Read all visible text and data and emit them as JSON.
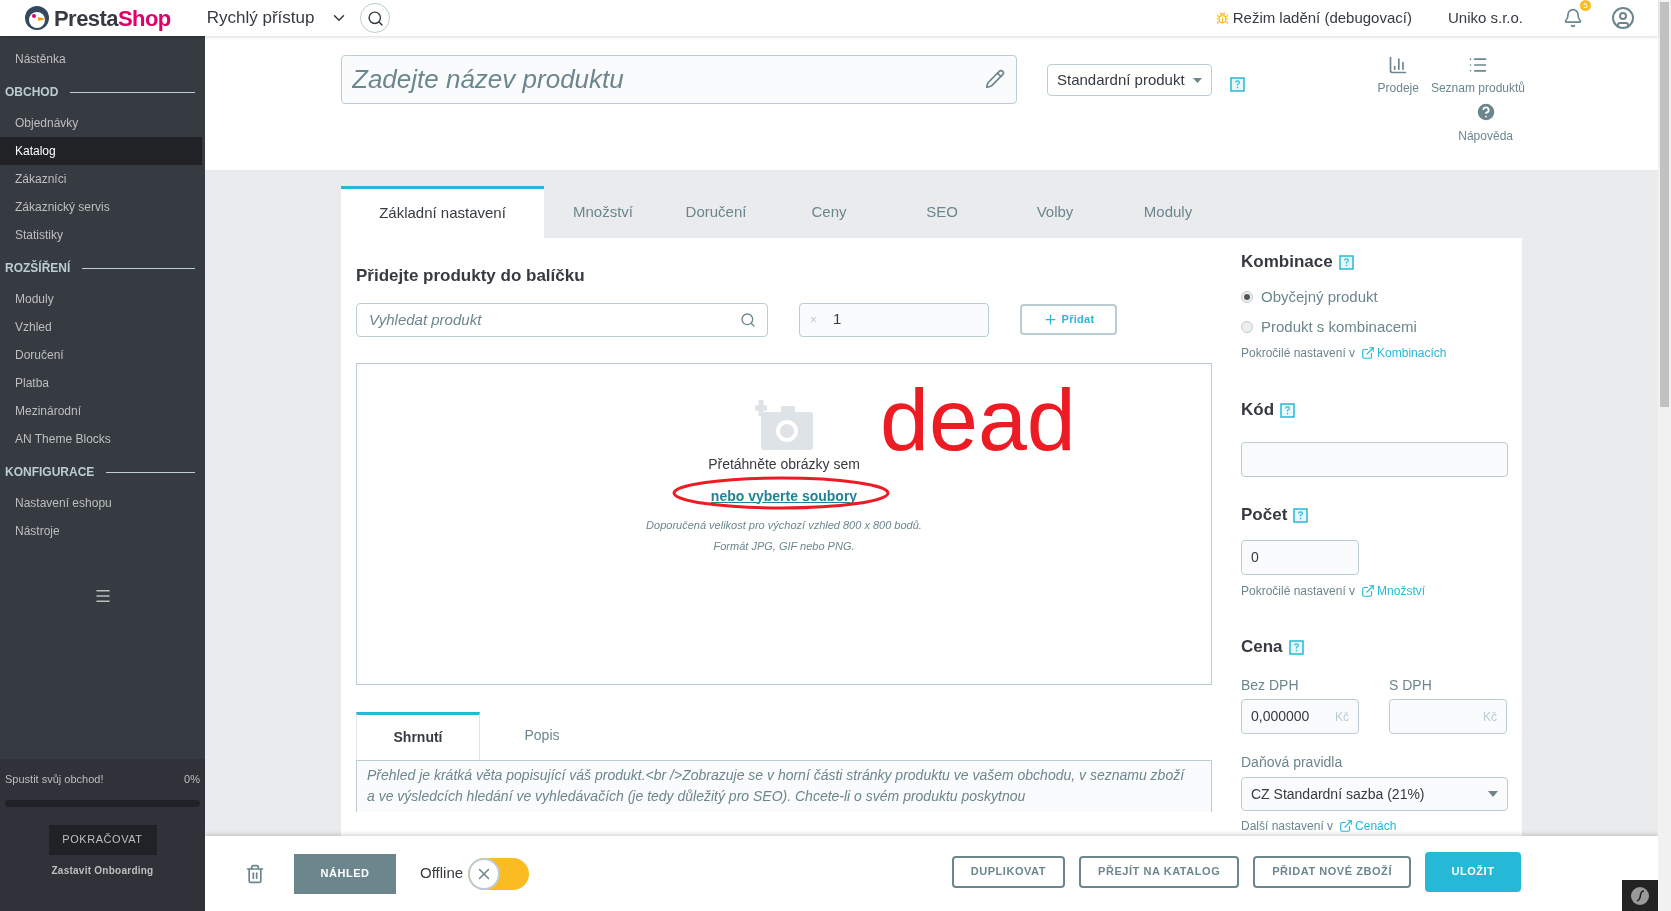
{
  "topbar": {
    "logo": [
      "Presta",
      "Shop"
    ],
    "quick_access": "Rychlý přístup",
    "debug_mode": "Režim ladění (debugovací)",
    "shop_name": "Uniko s.r.o.",
    "notifications_count": "5"
  },
  "sidebar": {
    "items": [
      {
        "kind": "item",
        "label": "Nástěnka",
        "selected": false
      },
      {
        "kind": "section",
        "label": "OBCHOD"
      },
      {
        "kind": "item",
        "label": "Objednávky",
        "selected": false
      },
      {
        "kind": "item",
        "label": "Katalog",
        "selected": true
      },
      {
        "kind": "item",
        "label": "Zákazníci",
        "selected": false
      },
      {
        "kind": "item",
        "label": "Zákaznický servis",
        "selected": false
      },
      {
        "kind": "item",
        "label": "Statistiky",
        "selected": false
      },
      {
        "kind": "section",
        "label": "ROZŠÍŘENÍ"
      },
      {
        "kind": "item",
        "label": "Moduly",
        "selected": false
      },
      {
        "kind": "item",
        "label": "Vzhled",
        "selected": false
      },
      {
        "kind": "item",
        "label": "Doručení",
        "selected": false
      },
      {
        "kind": "item",
        "label": "Platba",
        "selected": false
      },
      {
        "kind": "item",
        "label": "Mezinárodní",
        "selected": false
      },
      {
        "kind": "item",
        "label": "AN Theme Blocks",
        "selected": false
      },
      {
        "kind": "section",
        "label": "KONFIGURACE"
      },
      {
        "kind": "item",
        "label": "Nastavení eshopu",
        "selected": false
      },
      {
        "kind": "item",
        "label": "Nástroje",
        "selected": false
      }
    ],
    "onboarding": {
      "label": "Spustit svůj obchod!",
      "percent": "0%",
      "level": 0,
      "continue_button": "POKRAČOVAT",
      "stop_link": "Zastavit Onboarding"
    }
  },
  "header": {
    "name_placeholder": "Zadejte název produktu",
    "product_type": "Standardní produkt",
    "actions": [
      {
        "kind": "chart",
        "label": "Prodeje"
      },
      {
        "kind": "list",
        "label": "Seznam produktů"
      },
      {
        "kind": "help",
        "label": "Nápověda"
      }
    ]
  },
  "tabs": [
    {
      "label": "Základní nastavení",
      "selected": true
    },
    {
      "label": "Množství",
      "selected": false
    },
    {
      "label": "Doručení",
      "selected": false
    },
    {
      "label": "Ceny",
      "selected": false
    },
    {
      "label": "SEO",
      "selected": false
    },
    {
      "label": "Volby",
      "selected": false
    },
    {
      "label": "Moduly",
      "selected": false
    }
  ],
  "pack": {
    "title": "Přidejte produkty do balíčku",
    "search_placeholder": "Vyhledat produkt",
    "quantity_prefix": "×",
    "quantity": "1",
    "add_button": "Přidat"
  },
  "dropzone": {
    "drag_text": "Přetáhněte obrázky sem",
    "select_link": "nebo vyberte soubory",
    "size_hint": "Doporučená velikost pro výchozí vzhled 800 x 800 bodů.",
    "format_hint": "Formát JPG, GIF nebo PNG."
  },
  "annotation": {
    "text": "dead",
    "color": "#ed1c24"
  },
  "description_tabs": [
    {
      "label": "Shrnutí",
      "selected": true
    },
    {
      "label": "Popis",
      "selected": false
    }
  ],
  "summary_placeholder": "Přehled je krátká věta popisující váš produkt.<br />Zobrazuje se v horní části stránky produktu ve vašem obchodu, v seznamu zboží a ve výsledcích hledání ve vyhledávačích (je tedy důležitý pro SEO). Chcete-li o svém produktu poskytnou",
  "right_panel": {
    "combinations": {
      "title": "Kombinace",
      "options": [
        {
          "label": "Obyčejný produkt",
          "selected": true
        },
        {
          "label": "Produkt s kombinacemi",
          "selected": false
        }
      ],
      "hint": "Pokročilé nastavení v",
      "link": "Kombinacích"
    },
    "code": {
      "title": "Kód"
    },
    "quantity": {
      "title": "Počet",
      "value": "0",
      "hint": "Pokročilé nastavení v",
      "link": "Množství"
    },
    "price": {
      "title": "Cena",
      "without_tax_label": "Bez DPH",
      "without_tax_value": "0,000000",
      "with_tax_label": "S DPH",
      "currency_without_tax": "Kč",
      "currency_with_tax": "Kč",
      "tax_rules_label": "Daňová pravidla",
      "tax_rule": "CZ Standardní sazba (21%)",
      "hint": "Další nastavení v",
      "link": "Cenách"
    }
  },
  "footer": {
    "preview_button": "NÁHLED",
    "online_label": "Offline",
    "online": false,
    "buttons": [
      "DUPLIKOVAT",
      "PŘEJÍT NA KATALOG",
      "PŘIDAT NOVÉ ZBOŽÍ"
    ],
    "save_button": "ULOŽIT"
  }
}
